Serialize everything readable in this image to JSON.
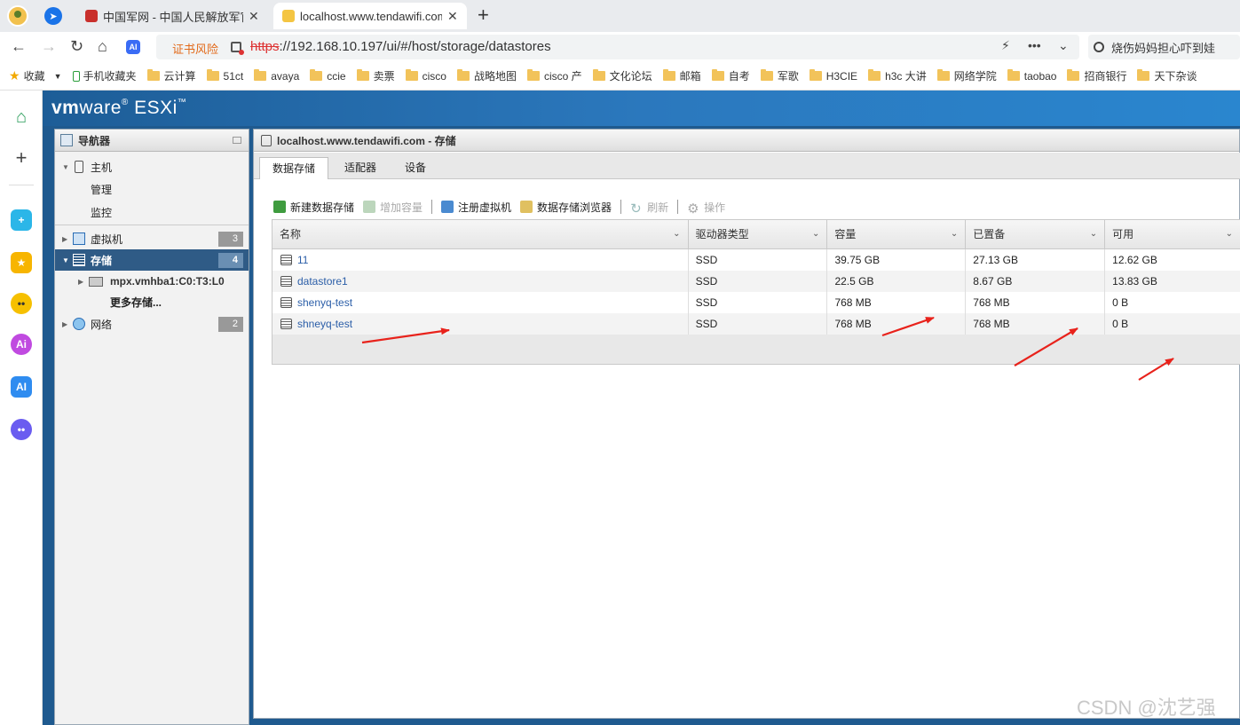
{
  "browser": {
    "tabs": [
      {
        "title": "中国军网 - 中国人民解放军官",
        "close": "✕"
      },
      {
        "title": "localhost.www.tendawifi.com",
        "close": "✕"
      }
    ],
    "new_tab": "+",
    "cert_warning": "证书风险",
    "url_scheme": "https",
    "url_rest": "://192.168.10.197/ui/#/host/storage/datastores",
    "search_text": "烧伤妈妈担心吓到娃",
    "bookmarks": [
      "收藏",
      "手机收藏夹",
      "云计算",
      "51ct",
      "avaya",
      "ccie",
      "卖票",
      "cisco",
      "战略地图",
      "cisco 产",
      "文化论坛",
      "邮箱",
      "自考",
      "军歌",
      "H3CIE",
      "h3c 大讲",
      "网络学院",
      "taobao",
      "招商银行",
      "天下杂谈"
    ]
  },
  "esxi": {
    "logo_vm": "vm",
    "logo_ware": "ware",
    "logo_product": "ESXi",
    "navigator": {
      "title": "导航器",
      "host": {
        "label": "主机",
        "children": [
          "管理",
          "监控"
        ]
      },
      "vms": {
        "label": "虚拟机",
        "count": "3"
      },
      "storage": {
        "label": "存储",
        "count": "4",
        "children": [
          "mpx.vmhba1:C0:T3:L0",
          "更多存储..."
        ]
      },
      "network": {
        "label": "网络",
        "count": "2"
      }
    },
    "main_title": "localhost.www.tendawifi.com - 存储",
    "tabs": [
      "数据存储",
      "适配器",
      "设备"
    ],
    "toolbar": {
      "new_datastore": "新建数据存储",
      "increase_capacity": "增加容量",
      "register_vm": "注册虚拟机",
      "browser": "数据存储浏览器",
      "refresh": "刷新",
      "actions": "操作"
    },
    "columns": [
      "名称",
      "驱动器类型",
      "容量",
      "已置备",
      "可用"
    ],
    "rows": [
      {
        "name": "11",
        "type": "SSD",
        "capacity": "39.75 GB",
        "provisioned": "27.13 GB",
        "free": "12.62 GB"
      },
      {
        "name": "datastore1",
        "type": "SSD",
        "capacity": "22.5 GB",
        "provisioned": "8.67 GB",
        "free": "13.83 GB"
      },
      {
        "name": "shenyq-test",
        "type": "SSD",
        "capacity": "768 MB",
        "provisioned": "768 MB",
        "free": "0 B"
      },
      {
        "name": "shneyq-test",
        "type": "SSD",
        "capacity": "768 MB",
        "provisioned": "768 MB",
        "free": "0 B"
      }
    ]
  },
  "watermark": "CSDN @沈艺强",
  "colors": {
    "accent": "#2b78bd",
    "selected": "#2f5b86",
    "arrow": "#e8221b",
    "cert": "#e26a1a"
  }
}
